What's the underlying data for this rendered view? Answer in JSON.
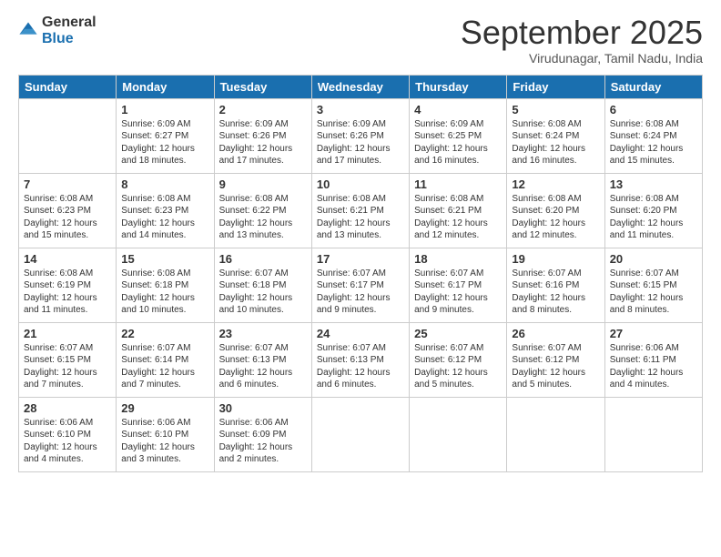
{
  "logo": {
    "general": "General",
    "blue": "Blue"
  },
  "header": {
    "title": "September 2025",
    "subtitle": "Virudunagar, Tamil Nadu, India"
  },
  "weekdays": [
    "Sunday",
    "Monday",
    "Tuesday",
    "Wednesday",
    "Thursday",
    "Friday",
    "Saturday"
  ],
  "weeks": [
    [
      {
        "day": "",
        "sunrise": "",
        "sunset": "",
        "daylight": ""
      },
      {
        "day": "1",
        "sunrise": "Sunrise: 6:09 AM",
        "sunset": "Sunset: 6:27 PM",
        "daylight": "Daylight: 12 hours and 18 minutes."
      },
      {
        "day": "2",
        "sunrise": "Sunrise: 6:09 AM",
        "sunset": "Sunset: 6:26 PM",
        "daylight": "Daylight: 12 hours and 17 minutes."
      },
      {
        "day": "3",
        "sunrise": "Sunrise: 6:09 AM",
        "sunset": "Sunset: 6:26 PM",
        "daylight": "Daylight: 12 hours and 17 minutes."
      },
      {
        "day": "4",
        "sunrise": "Sunrise: 6:09 AM",
        "sunset": "Sunset: 6:25 PM",
        "daylight": "Daylight: 12 hours and 16 minutes."
      },
      {
        "day": "5",
        "sunrise": "Sunrise: 6:08 AM",
        "sunset": "Sunset: 6:24 PM",
        "daylight": "Daylight: 12 hours and 16 minutes."
      },
      {
        "day": "6",
        "sunrise": "Sunrise: 6:08 AM",
        "sunset": "Sunset: 6:24 PM",
        "daylight": "Daylight: 12 hours and 15 minutes."
      }
    ],
    [
      {
        "day": "7",
        "sunrise": "Sunrise: 6:08 AM",
        "sunset": "Sunset: 6:23 PM",
        "daylight": "Daylight: 12 hours and 15 minutes."
      },
      {
        "day": "8",
        "sunrise": "Sunrise: 6:08 AM",
        "sunset": "Sunset: 6:23 PM",
        "daylight": "Daylight: 12 hours and 14 minutes."
      },
      {
        "day": "9",
        "sunrise": "Sunrise: 6:08 AM",
        "sunset": "Sunset: 6:22 PM",
        "daylight": "Daylight: 12 hours and 13 minutes."
      },
      {
        "day": "10",
        "sunrise": "Sunrise: 6:08 AM",
        "sunset": "Sunset: 6:21 PM",
        "daylight": "Daylight: 12 hours and 13 minutes."
      },
      {
        "day": "11",
        "sunrise": "Sunrise: 6:08 AM",
        "sunset": "Sunset: 6:21 PM",
        "daylight": "Daylight: 12 hours and 12 minutes."
      },
      {
        "day": "12",
        "sunrise": "Sunrise: 6:08 AM",
        "sunset": "Sunset: 6:20 PM",
        "daylight": "Daylight: 12 hours and 12 minutes."
      },
      {
        "day": "13",
        "sunrise": "Sunrise: 6:08 AM",
        "sunset": "Sunset: 6:20 PM",
        "daylight": "Daylight: 12 hours and 11 minutes."
      }
    ],
    [
      {
        "day": "14",
        "sunrise": "Sunrise: 6:08 AM",
        "sunset": "Sunset: 6:19 PM",
        "daylight": "Daylight: 12 hours and 11 minutes."
      },
      {
        "day": "15",
        "sunrise": "Sunrise: 6:08 AM",
        "sunset": "Sunset: 6:18 PM",
        "daylight": "Daylight: 12 hours and 10 minutes."
      },
      {
        "day": "16",
        "sunrise": "Sunrise: 6:07 AM",
        "sunset": "Sunset: 6:18 PM",
        "daylight": "Daylight: 12 hours and 10 minutes."
      },
      {
        "day": "17",
        "sunrise": "Sunrise: 6:07 AM",
        "sunset": "Sunset: 6:17 PM",
        "daylight": "Daylight: 12 hours and 9 minutes."
      },
      {
        "day": "18",
        "sunrise": "Sunrise: 6:07 AM",
        "sunset": "Sunset: 6:17 PM",
        "daylight": "Daylight: 12 hours and 9 minutes."
      },
      {
        "day": "19",
        "sunrise": "Sunrise: 6:07 AM",
        "sunset": "Sunset: 6:16 PM",
        "daylight": "Daylight: 12 hours and 8 minutes."
      },
      {
        "day": "20",
        "sunrise": "Sunrise: 6:07 AM",
        "sunset": "Sunset: 6:15 PM",
        "daylight": "Daylight: 12 hours and 8 minutes."
      }
    ],
    [
      {
        "day": "21",
        "sunrise": "Sunrise: 6:07 AM",
        "sunset": "Sunset: 6:15 PM",
        "daylight": "Daylight: 12 hours and 7 minutes."
      },
      {
        "day": "22",
        "sunrise": "Sunrise: 6:07 AM",
        "sunset": "Sunset: 6:14 PM",
        "daylight": "Daylight: 12 hours and 7 minutes."
      },
      {
        "day": "23",
        "sunrise": "Sunrise: 6:07 AM",
        "sunset": "Sunset: 6:13 PM",
        "daylight": "Daylight: 12 hours and 6 minutes."
      },
      {
        "day": "24",
        "sunrise": "Sunrise: 6:07 AM",
        "sunset": "Sunset: 6:13 PM",
        "daylight": "Daylight: 12 hours and 6 minutes."
      },
      {
        "day": "25",
        "sunrise": "Sunrise: 6:07 AM",
        "sunset": "Sunset: 6:12 PM",
        "daylight": "Daylight: 12 hours and 5 minutes."
      },
      {
        "day": "26",
        "sunrise": "Sunrise: 6:07 AM",
        "sunset": "Sunset: 6:12 PM",
        "daylight": "Daylight: 12 hours and 5 minutes."
      },
      {
        "day": "27",
        "sunrise": "Sunrise: 6:06 AM",
        "sunset": "Sunset: 6:11 PM",
        "daylight": "Daylight: 12 hours and 4 minutes."
      }
    ],
    [
      {
        "day": "28",
        "sunrise": "Sunrise: 6:06 AM",
        "sunset": "Sunset: 6:10 PM",
        "daylight": "Daylight: 12 hours and 4 minutes."
      },
      {
        "day": "29",
        "sunrise": "Sunrise: 6:06 AM",
        "sunset": "Sunset: 6:10 PM",
        "daylight": "Daylight: 12 hours and 3 minutes."
      },
      {
        "day": "30",
        "sunrise": "Sunrise: 6:06 AM",
        "sunset": "Sunset: 6:09 PM",
        "daylight": "Daylight: 12 hours and 2 minutes."
      },
      {
        "day": "",
        "sunrise": "",
        "sunset": "",
        "daylight": ""
      },
      {
        "day": "",
        "sunrise": "",
        "sunset": "",
        "daylight": ""
      },
      {
        "day": "",
        "sunrise": "",
        "sunset": "",
        "daylight": ""
      },
      {
        "day": "",
        "sunrise": "",
        "sunset": "",
        "daylight": ""
      }
    ]
  ]
}
